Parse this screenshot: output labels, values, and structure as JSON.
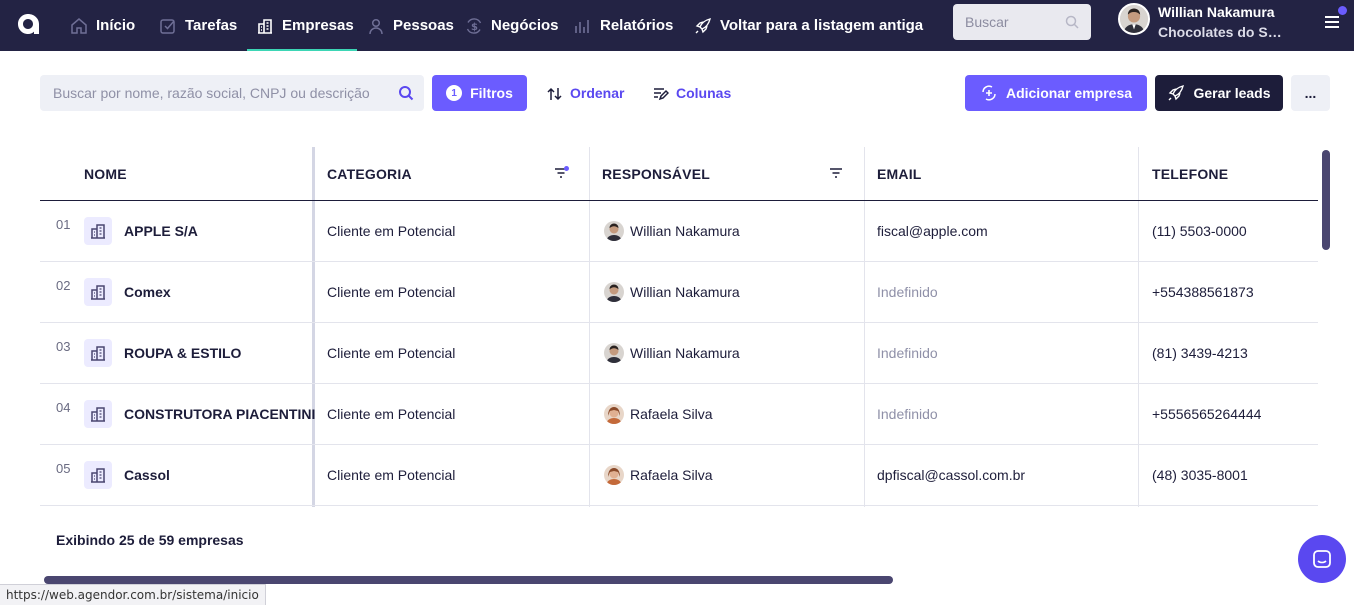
{
  "nav": {
    "items": [
      {
        "label": "Início",
        "icon": "home-icon"
      },
      {
        "label": "Tarefas",
        "icon": "tasks-icon"
      },
      {
        "label": "Empresas",
        "icon": "building-icon"
      },
      {
        "label": "Pessoas",
        "icon": "person-icon"
      },
      {
        "label": "Negócios",
        "icon": "dollar-icon"
      },
      {
        "label": "Relatórios",
        "icon": "chart-icon"
      }
    ],
    "back_link": "Voltar para a listagem antiga",
    "search_placeholder": "Buscar",
    "user_name": "Willian Nakamura",
    "user_company": "Chocolates do Sul..."
  },
  "toolbar": {
    "search_placeholder": "Buscar por nome, razão social, CNPJ ou descrição",
    "filter_count": "1",
    "filter_label": "Filtros",
    "sort_label": "Ordenar",
    "columns_label": "Colunas",
    "add_label": "Adicionar empresa",
    "leads_label": "Gerar leads",
    "more_label": "..."
  },
  "table": {
    "headers": [
      "NOME",
      "CATEGORIA",
      "RESPONSÁVEL",
      "EMAIL",
      "TELEFONE"
    ],
    "rows": [
      {
        "num": "01",
        "name": "APPLE S/A",
        "category": "Cliente em Potencial",
        "owner": "Willian Nakamura",
        "email": "fiscal@apple.com",
        "phone": "(11) 5503-0000"
      },
      {
        "num": "02",
        "name": "Comex",
        "category": "Cliente em Potencial",
        "owner": "Willian Nakamura",
        "email": "Indefinido",
        "phone": "+554388561873"
      },
      {
        "num": "03",
        "name": "ROUPA & ESTILO",
        "category": "Cliente em Potencial",
        "owner": "Willian Nakamura",
        "email": "Indefinido",
        "phone": "(81) 3439-4213"
      },
      {
        "num": "04",
        "name": "CONSTRUTORA PIACENTINI",
        "category": "Cliente em Potencial",
        "owner": "Rafaela Silva",
        "email": "Indefinido",
        "phone": "+5556565264444"
      },
      {
        "num": "05",
        "name": "Cassol",
        "category": "Cliente em Potencial",
        "owner": "Rafaela Silva",
        "email": "dpfiscal@cassol.com.br",
        "phone": "(48) 3035-8001"
      }
    ]
  },
  "footer": {
    "count_text": "Exibindo 25 de 59 empresas",
    "status_url": "https://web.agendor.com.br/sistema/inicio"
  },
  "colors": {
    "nav_bg": "#232344",
    "accent": "#6b5cff",
    "active_underline": "#3dd6b5",
    "dark_button": "#1d1d3a"
  }
}
